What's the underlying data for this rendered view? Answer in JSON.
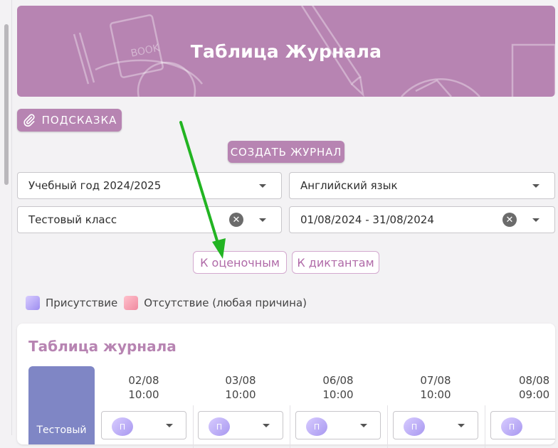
{
  "banner": {
    "title": "Таблица Журнала"
  },
  "hint_button": {
    "label": "ПОДСКАЗКА",
    "icon": "paperclip-icon"
  },
  "create_button": {
    "label": "СОЗДАТЬ ЖУРНАЛ"
  },
  "filters": {
    "year": "Учебный год 2024/2025",
    "subject": "Английский язык",
    "class": "Тестовый класс",
    "date_range": "01/08/2024 - 31/08/2024"
  },
  "nav_buttons": {
    "assessments": "К оценочным",
    "dictations": "К диктантам"
  },
  "legend": {
    "present": "Присутствие",
    "absent": "Отсутствие (любая причина)"
  },
  "journal": {
    "title": "Таблица журнала",
    "student_name": "Тестовый",
    "columns": [
      {
        "date": "02/08",
        "time": "10:00",
        "mark": "П"
      },
      {
        "date": "03/08",
        "time": "10:00",
        "mark": "П"
      },
      {
        "date": "06/08",
        "time": "10:00",
        "mark": "П"
      },
      {
        "date": "07/08",
        "time": "10:00",
        "mark": "П"
      },
      {
        "date": "08/08",
        "time": "09:00",
        "mark": "П"
      }
    ]
  },
  "colors": {
    "accent": "#b784b2",
    "student_cell": "#7f86c5",
    "arrow": "#22b422"
  }
}
